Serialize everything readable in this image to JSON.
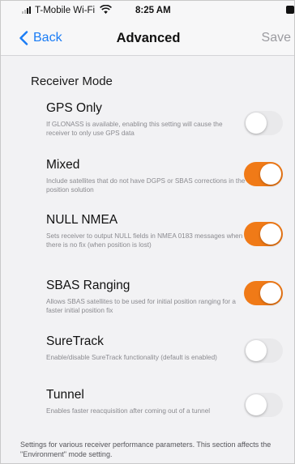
{
  "status_bar": {
    "carrier": "T-Mobile Wi-Fi",
    "time": "8:25 AM"
  },
  "nav": {
    "back_label": "Back",
    "title": "Advanced",
    "save_label": "Save"
  },
  "section": {
    "header": "Receiver Mode",
    "footer": "Settings for various receiver performance parameters. This section affects the \"Environment\" mode setting."
  },
  "settings": [
    {
      "title": "GPS Only",
      "description": "If GLONASS is available, enabling this setting will cause the receiver to only use GPS data",
      "enabled": false
    },
    {
      "title": "Mixed",
      "description": "Include satellites that do not have DGPS or SBAS corrections in the position solution",
      "enabled": true
    },
    {
      "title": "NULL NMEA",
      "description": "Sets receiver to output NULL fields in NMEA 0183 messages when there is no fix (when position is lost)",
      "enabled": true
    },
    {
      "title": "SBAS Ranging",
      "description": "Allows SBAS satellites to be used for initial position ranging for a faster initial position fix",
      "enabled": true
    },
    {
      "title": "SureTrack",
      "description": "Enable/disable SureTrack functionality (default is enabled)",
      "enabled": false
    },
    {
      "title": "Tunnel",
      "description": "Enables faster reacquisition after coming out of a tunnel",
      "enabled": false
    }
  ],
  "colors": {
    "accent": "#1a7cf5",
    "toggle_on": "#f07a17",
    "toggle_off": "#e9e9eb"
  }
}
